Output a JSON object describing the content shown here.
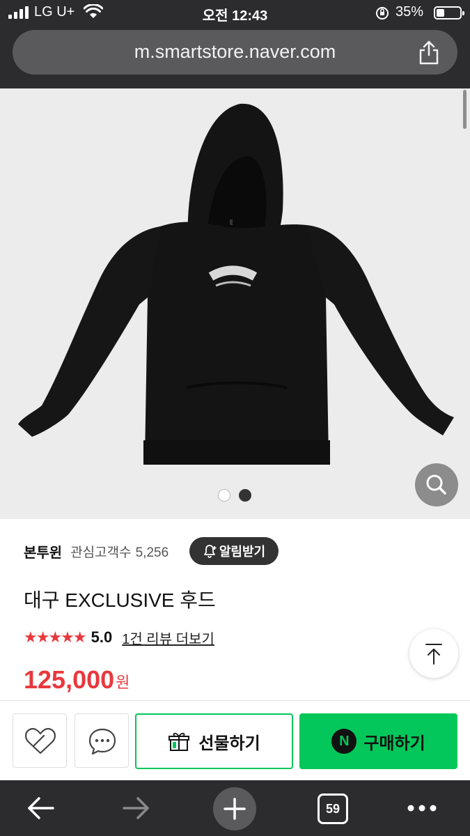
{
  "status_bar": {
    "carrier": "LG U+",
    "time": "오전 12:43",
    "battery_percent": "35%",
    "battery_level": 0.35
  },
  "browser": {
    "url": "m.smartstore.naver.com",
    "tab_count": "59"
  },
  "gallery": {
    "image_count": 2,
    "active_index": 1
  },
  "store": {
    "name": "본투윈",
    "interest_label": "관심고객수",
    "interest_count": "5,256",
    "alarm_button": "알림받기"
  },
  "product": {
    "title": "대구 EXCLUSIVE 후드",
    "stars": "★★★★★",
    "rating": "5.0",
    "review_link": "1건 리뷰 더보기",
    "price": "125,000",
    "currency": "원"
  },
  "purchase_bar": {
    "gift_label": "선물하기",
    "buy_label": "구매하기",
    "buy_badge": "N"
  },
  "colors": {
    "naver_green": "#03c75a",
    "price_red": "#e8383d",
    "chrome_dark": "#2c2c2e"
  }
}
